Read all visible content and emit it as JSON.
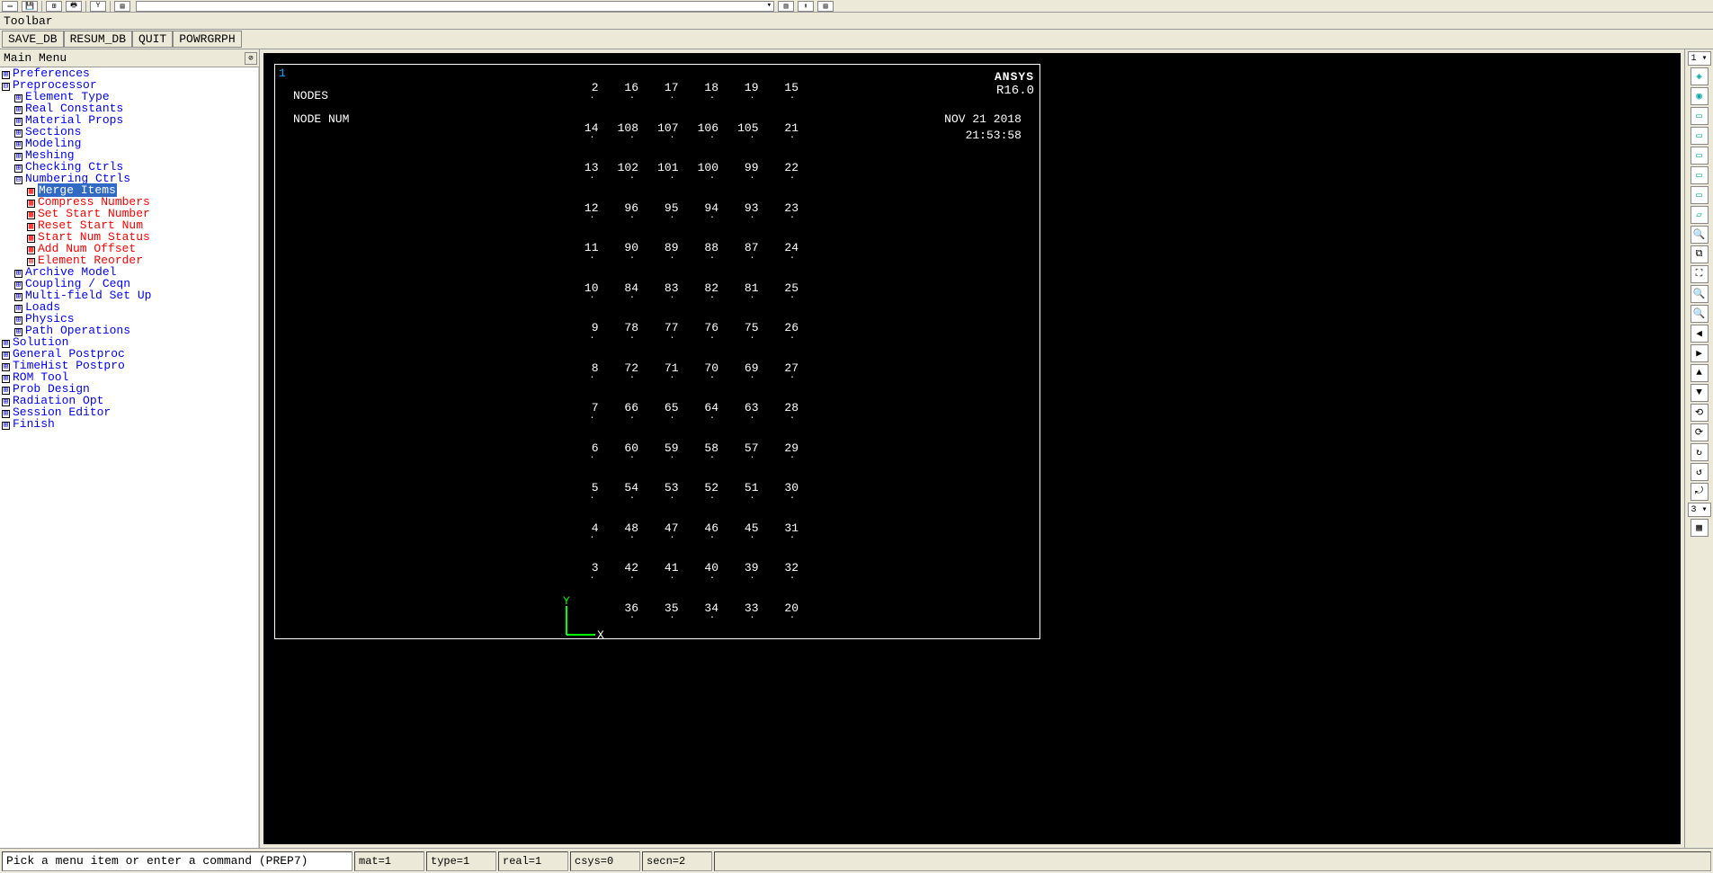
{
  "toolbar_label": "Toolbar",
  "buttons": {
    "save_db": "SAVE_DB",
    "resum_db": "RESUM_DB",
    "quit": "QUIT",
    "powrgrph": "POWRGRPH"
  },
  "main_menu_title": "Main Menu",
  "tree": [
    {
      "lvl": 0,
      "sq": "⊞",
      "cls": "blue",
      "label": "Preferences",
      "sel": false
    },
    {
      "lvl": 0,
      "sq": "⊟",
      "cls": "blue",
      "label": "Preprocessor",
      "sel": false
    },
    {
      "lvl": 1,
      "sq": "⊞",
      "cls": "blue",
      "label": "Element Type",
      "sel": false
    },
    {
      "lvl": 1,
      "sq": "⊞",
      "cls": "blue",
      "label": "Real Constants",
      "sel": false
    },
    {
      "lvl": 1,
      "sq": "⊞",
      "cls": "blue",
      "label": "Material Props",
      "sel": false
    },
    {
      "lvl": 1,
      "sq": "⊞",
      "cls": "blue",
      "label": "Sections",
      "sel": false
    },
    {
      "lvl": 1,
      "sq": "⊞",
      "cls": "blue",
      "label": "Modeling",
      "sel": false
    },
    {
      "lvl": 1,
      "sq": "⊞",
      "cls": "blue",
      "label": "Meshing",
      "sel": false
    },
    {
      "lvl": 1,
      "sq": "⊞",
      "cls": "blue",
      "label": "Checking Ctrls",
      "sel": false
    },
    {
      "lvl": 1,
      "sq": "⊟",
      "cls": "blue",
      "label": "Numbering Ctrls",
      "sel": false
    },
    {
      "lvl": 2,
      "sq": "▦",
      "cls": "red",
      "label": "Merge Items",
      "sel": true
    },
    {
      "lvl": 2,
      "sq": "▦",
      "cls": "red",
      "label": "Compress Numbers",
      "sel": false
    },
    {
      "lvl": 2,
      "sq": "▦",
      "cls": "red",
      "label": "Set Start Number",
      "sel": false
    },
    {
      "lvl": 2,
      "sq": "▦",
      "cls": "red",
      "label": "Reset Start Num",
      "sel": false
    },
    {
      "lvl": 2,
      "sq": "▦",
      "cls": "red",
      "label": "Start Num Status",
      "sel": false
    },
    {
      "lvl": 2,
      "sq": "▦",
      "cls": "red",
      "label": "Add Num Offset",
      "sel": false
    },
    {
      "lvl": 2,
      "sq": "⊞",
      "cls": "red",
      "label": "Element Reorder",
      "sel": false
    },
    {
      "lvl": 1,
      "sq": "⊞",
      "cls": "blue",
      "label": "Archive Model",
      "sel": false
    },
    {
      "lvl": 1,
      "sq": "⊞",
      "cls": "blue",
      "label": "Coupling / Ceqn",
      "sel": false
    },
    {
      "lvl": 1,
      "sq": "⊞",
      "cls": "blue",
      "label": "Multi-field Set Up",
      "sel": false
    },
    {
      "lvl": 1,
      "sq": "⊞",
      "cls": "blue",
      "label": "Loads",
      "sel": false
    },
    {
      "lvl": 1,
      "sq": "⊞",
      "cls": "blue",
      "label": "Physics",
      "sel": false
    },
    {
      "lvl": 1,
      "sq": "⊞",
      "cls": "blue",
      "label": "Path Operations",
      "sel": false
    },
    {
      "lvl": 0,
      "sq": "⊞",
      "cls": "blue",
      "label": "Solution",
      "sel": false
    },
    {
      "lvl": 0,
      "sq": "⊞",
      "cls": "blue",
      "label": "General Postproc",
      "sel": false
    },
    {
      "lvl": 0,
      "sq": "⊞",
      "cls": "blue",
      "label": "TimeHist Postpro",
      "sel": false
    },
    {
      "lvl": 0,
      "sq": "⊞",
      "cls": "blue",
      "label": "ROM Tool",
      "sel": false
    },
    {
      "lvl": 0,
      "sq": "⊞",
      "cls": "blue",
      "label": "Prob Design",
      "sel": false
    },
    {
      "lvl": 0,
      "sq": "⊞",
      "cls": "blue",
      "label": "Radiation Opt",
      "sel": false
    },
    {
      "lvl": 0,
      "sq": "⊞",
      "cls": "blue",
      "label": "Session Editor",
      "sel": false
    },
    {
      "lvl": 0,
      "sq": "⊞",
      "cls": "blue",
      "label": "Finish",
      "sel": false
    }
  ],
  "viewport": {
    "corner": "1",
    "label1": "NODES",
    "label2": "NODE NUM",
    "logo": "ANSYS",
    "version": "R16.0",
    "date": "NOV 21 2018",
    "time": "21:53:58",
    "triad_y": "Y",
    "triad_x": "X",
    "nodes": [
      [
        "2",
        "16",
        "17",
        "18",
        "19",
        "15"
      ],
      [
        "14",
        "108",
        "107",
        "106",
        "105",
        "21"
      ],
      [
        "13",
        "102",
        "101",
        "100",
        "99",
        "22"
      ],
      [
        "12",
        "96",
        "95",
        "94",
        "93",
        "23"
      ],
      [
        "11",
        "90",
        "89",
        "88",
        "87",
        "24"
      ],
      [
        "10",
        "84",
        "83",
        "82",
        "81",
        "25"
      ],
      [
        "9",
        "78",
        "77",
        "76",
        "75",
        "26"
      ],
      [
        "8",
        "72",
        "71",
        "70",
        "69",
        "27"
      ],
      [
        "7",
        "66",
        "65",
        "64",
        "63",
        "28"
      ],
      [
        "6",
        "60",
        "59",
        "58",
        "57",
        "29"
      ],
      [
        "5",
        "54",
        "53",
        "52",
        "51",
        "30"
      ],
      [
        "4",
        "48",
        "47",
        "46",
        "45",
        "31"
      ],
      [
        "3",
        "42",
        "41",
        "40",
        "39",
        "32"
      ],
      [
        "",
        "36",
        "35",
        "34",
        "33",
        "20"
      ]
    ]
  },
  "right_tools": {
    "win_sel_top": "1 ▾",
    "win_sel_bot": "3 ▾",
    "icons": [
      "iso",
      "fit",
      "front",
      "top",
      "right",
      "back",
      "left",
      "obl",
      "zoom-in",
      "zoom-box",
      "zoom-fit",
      "zoom-win",
      "zoom-out",
      "pan-l",
      "pan-r",
      "pan-u",
      "pan-d",
      "rot-x",
      "rot-y",
      "rot-z",
      "rot-yc",
      "rot-zc",
      "multi-plot"
    ]
  },
  "status": {
    "prompt": "Pick a menu item or enter a command (PREP7)",
    "mat": "mat=1",
    "type": "type=1",
    "real": "real=1",
    "csys": "csys=0",
    "secn": "secn=2"
  }
}
